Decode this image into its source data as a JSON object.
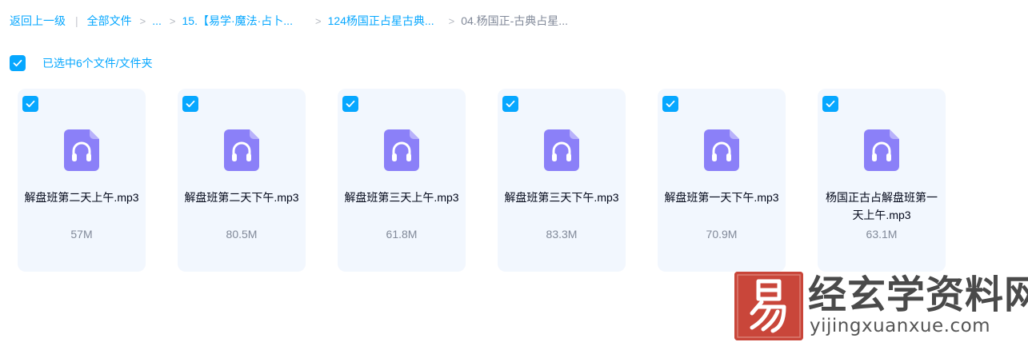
{
  "breadcrumb": {
    "back": "返回上一级",
    "divider": "|",
    "sep": ">",
    "items": [
      "全部文件",
      "...",
      "15.【易学·魔法·占卜...",
      "124杨国正占星古典...",
      "04.杨国正-古典占星..."
    ]
  },
  "selection": {
    "text": "已选中6个文件/文件夹"
  },
  "files": [
    {
      "name": "解盘班第二天上午.mp3",
      "size": "57M",
      "icon": "headphones-audio-icon",
      "selected": true
    },
    {
      "name": "解盘班第二天下午.mp3",
      "size": "80.5M",
      "icon": "headphones-audio-icon",
      "selected": true
    },
    {
      "name": "解盘班第三天上午.mp3",
      "size": "61.8M",
      "icon": "headphones-audio-icon",
      "selected": true
    },
    {
      "name": "解盘班第三天下午.mp3",
      "size": "83.3M",
      "icon": "headphones-audio-icon",
      "selected": true
    },
    {
      "name": "解盘班第一天下午.mp3",
      "size": "70.9M",
      "icon": "headphones-audio-icon",
      "selected": true
    },
    {
      "name": "杨国正古占解盘班第一天上午.mp3",
      "size": "63.1M",
      "icon": "headphones-audio-icon",
      "selected": true
    }
  ],
  "watermark": {
    "logo_char": "易",
    "title": "经玄学资料网",
    "url": "yijingxuanxue.com"
  },
  "colors": {
    "accent": "#06a7ff",
    "card_bg": "#f2f7fe",
    "icon_purple": "#8b80f8",
    "watermark_red": "#c9463a"
  }
}
